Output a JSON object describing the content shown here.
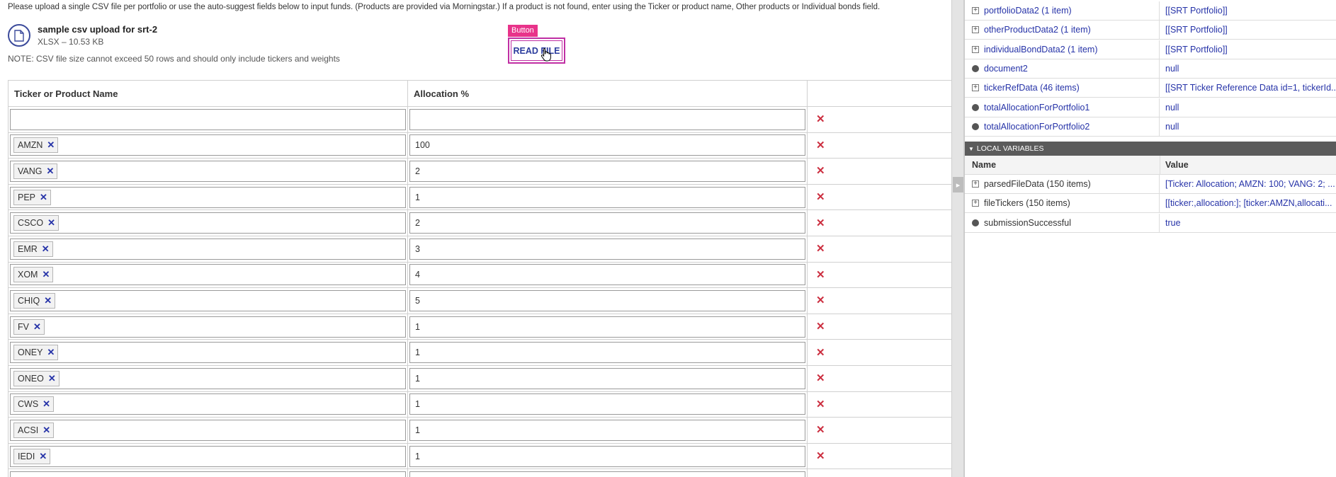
{
  "instructions": "Please upload a single CSV file per portfolio or use the auto-suggest fields below to input funds. (Products are provided via Morningstar.) If a product is not found, enter using the Ticker or product name, Other products or Individual bonds field.",
  "file": {
    "name": "sample csv upload for srt-2",
    "meta": "XLSX – 10.53 KB",
    "icon": "document-icon"
  },
  "note": "NOTE: CSV file size cannot exceed 50 rows and should only include tickers and weights",
  "read_button": {
    "tag": "Button",
    "label": "READ FILE"
  },
  "grid": {
    "headers": [
      "Ticker or Product Name",
      "Allocation %",
      ""
    ],
    "rows": [
      {
        "ticker": "",
        "allocation": ""
      },
      {
        "ticker": "AMZN",
        "allocation": "100"
      },
      {
        "ticker": "VANG",
        "allocation": "2"
      },
      {
        "ticker": "PEP",
        "allocation": "1"
      },
      {
        "ticker": "CSCO",
        "allocation": "2"
      },
      {
        "ticker": "EMR",
        "allocation": "3"
      },
      {
        "ticker": "XOM",
        "allocation": "4"
      },
      {
        "ticker": "CHIQ",
        "allocation": "5"
      },
      {
        "ticker": "FV",
        "allocation": "1"
      },
      {
        "ticker": "ONEY",
        "allocation": "1"
      },
      {
        "ticker": "ONEO",
        "allocation": "1"
      },
      {
        "ticker": "CWS",
        "allocation": "1"
      },
      {
        "ticker": "ACSI",
        "allocation": "1"
      },
      {
        "ticker": "IEDI",
        "allocation": "1"
      },
      {
        "ticker": "",
        "allocation": ""
      }
    ],
    "chip_remove_glyph": "✕",
    "delete_glyph": "✕"
  },
  "debug": {
    "top_rows": [
      {
        "name": "portfolioData2 (1 item)",
        "value": "[[SRT Portfolio]]",
        "kind": "expand"
      },
      {
        "name": "otherProductData2 (1 item)",
        "value": "[[SRT Portfolio]]",
        "kind": "expand"
      },
      {
        "name": "individualBondData2 (1 item)",
        "value": "[[SRT Portfolio]]",
        "kind": "expand"
      },
      {
        "name": "document2",
        "value": "null",
        "kind": "dot"
      },
      {
        "name": "tickerRefData (46 items)",
        "value": "[[SRT Ticker Reference Data id=1, tickerId...",
        "kind": "expand"
      },
      {
        "name": "totalAllocationForPortfolio1",
        "value": "null",
        "kind": "dot"
      },
      {
        "name": "totalAllocationForPortfolio2",
        "value": "null",
        "kind": "dot"
      }
    ],
    "section_title": "LOCAL VARIABLES",
    "col_name": "Name",
    "col_value": "Value",
    "local_rows": [
      {
        "name": "parsedFileData (150 items)",
        "value": "[Ticker: Allocation; AMZN: 100; VANG: 2; ...",
        "kind": "expand"
      },
      {
        "name": "fileTickers (150 items)",
        "value": "[[ticker:,allocation:]; [ticker:AMZN,allocati...",
        "kind": "expand"
      },
      {
        "name": "submissionSuccessful",
        "value": "true",
        "kind": "dot"
      }
    ]
  },
  "colors": {
    "accent_blue": "#2633a8",
    "delete_red": "#cc2f40",
    "button_highlight": "#c02fa4",
    "tag_pink": "#e8338a",
    "section_header": "#5b5b5b"
  }
}
